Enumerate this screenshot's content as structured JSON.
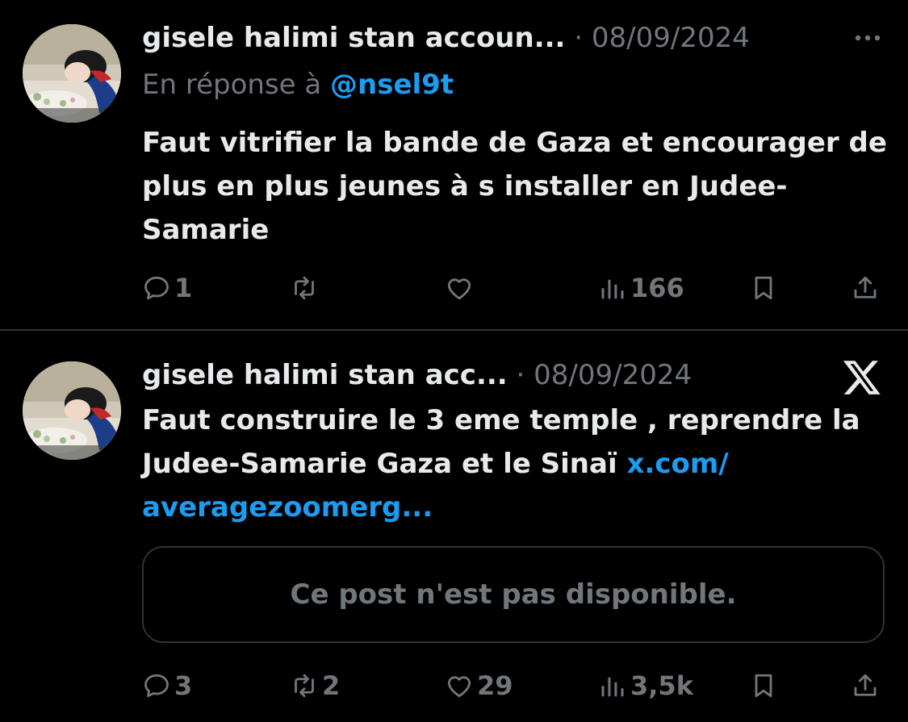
{
  "tweets": [
    {
      "author": "gisele halimi stan accoun...",
      "separator": "·",
      "date": "08/09/2024",
      "reply_prefix": "En réponse à",
      "reply_handle": "@nsel9t",
      "text": "Faut vitrifier la bande de Gaza et encourager de plus en plus  jeunes à s installer en Judee-Samarie",
      "more_icon": "more-icon",
      "actions": {
        "replies": "1",
        "reposts": "",
        "likes": "",
        "views": "166"
      }
    },
    {
      "author": "gisele halimi stan acc...",
      "separator": "·",
      "date": "08/09/2024",
      "text": "Faut construire le 3 eme temple , reprendre la Judee-Samarie Gaza et le Sinaï",
      "link_text": "x.com/ averagezoomerg...",
      "quote_unavailable": "Ce post n'est pas disponible.",
      "brand_icon": "x-logo-icon",
      "actions": {
        "replies": "3",
        "reposts": "2",
        "likes": "29",
        "views": "3,5k"
      }
    }
  ],
  "colors": {
    "background": "#000000",
    "text": "#e7e9ea",
    "secondary": "#71767b",
    "accent": "#1d9bf0",
    "border": "#2f3336"
  }
}
